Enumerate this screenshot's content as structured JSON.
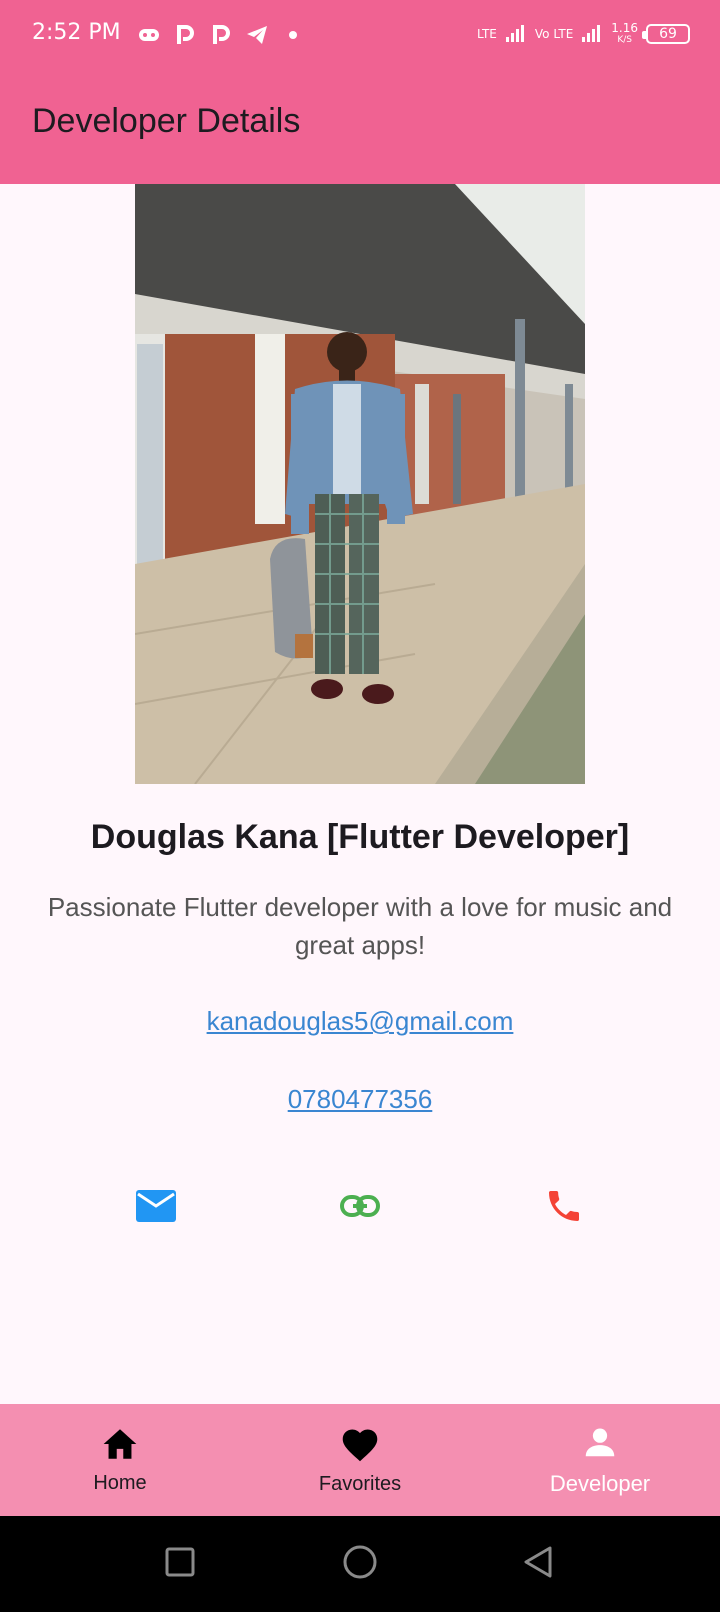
{
  "status_bar": {
    "time": "2:52 PM",
    "network1": "LTE",
    "network2": "Vo LTE",
    "speed_value": "1.16",
    "speed_unit": "K/S",
    "battery": "69",
    "notification_icons": [
      "game-controller-icon",
      "p-icon",
      "p-icon",
      "telegram-icon",
      "dot-icon"
    ]
  },
  "app_bar": {
    "title": "Developer Details"
  },
  "profile": {
    "name": "Douglas Kana [Flutter Developer]",
    "bio": "Passionate Flutter developer with a love for music and great apps!",
    "email": "kanadouglas5@gmail.com",
    "phone": "0780477356"
  },
  "actions": [
    {
      "icon": "email-icon",
      "color": "#2196f3"
    },
    {
      "icon": "link-icon",
      "color": "#4caf50"
    },
    {
      "icon": "phone-icon",
      "color": "#f44336"
    }
  ],
  "bottom_nav": {
    "items": [
      {
        "label": "Home",
        "icon": "home-icon"
      },
      {
        "label": "Favorites",
        "icon": "heart-icon"
      },
      {
        "label": "Developer",
        "icon": "person-icon",
        "active": true
      }
    ]
  },
  "colors": {
    "accent": "#f06292",
    "nav_background": "#f48fb1",
    "page_background": "#fff7fc",
    "link": "#3a86d1"
  }
}
